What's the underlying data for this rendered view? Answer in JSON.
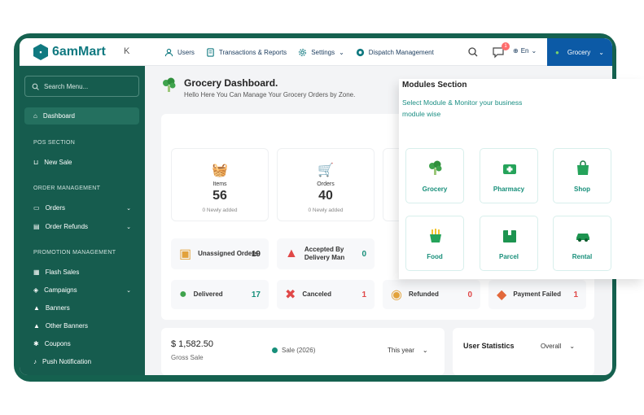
{
  "app": {
    "logo_text": "6amMart",
    "collapse_glyph": "K"
  },
  "topbar": {
    "nav": [
      {
        "label": "Users",
        "icon": "user-icon"
      },
      {
        "label": "Transactions & Reports",
        "icon": "report-icon"
      },
      {
        "label": "Settings",
        "icon": "gear-icon"
      },
      {
        "label": "Dispatch Management",
        "icon": "dispatch-icon"
      }
    ],
    "message_badge": "1",
    "language": "En",
    "module_select": "Grocery"
  },
  "sidebar": {
    "search_placeholder": "Search Menu...",
    "dashboard": "Dashboard",
    "pos_section": "POS SECTION",
    "new_sale": "New Sale",
    "order_section": "ORDER MANAGEMENT",
    "orders": "Orders",
    "order_refunds": "Order Refunds",
    "promo_section": "PROMOTION MANAGEMENT",
    "flash_sales": "Flash Sales",
    "campaigns": "Campaigns",
    "banners": "Banners",
    "other_banners": "Other Banners",
    "coupons": "Coupons",
    "push_notification": "Push Notification"
  },
  "main": {
    "title": "Grocery Dashboard.",
    "subtitle": "Hello Here You Can Manage Your Grocery Orders by Zone.",
    "stats": [
      {
        "label": "Items",
        "value": "56",
        "sub": "0 Newly added"
      },
      {
        "label": "Orders",
        "value": "40",
        "sub": "0 Newly added"
      }
    ],
    "status": {
      "unassigned_label": "Unassigned Orders",
      "unassigned_value": "19",
      "accepted_label": "Accepted By Delivery Man",
      "accepted_value": "0",
      "delivered_label": "Delivered",
      "delivered_value": "17",
      "canceled_label": "Canceled",
      "canceled_value": "1",
      "refunded_label": "Refunded",
      "refunded_value": "0",
      "failed_label": "Payment Failed",
      "failed_value": "1"
    },
    "gross": {
      "amount": "$ 1,582.50",
      "label": "Gross Sale",
      "legend": "Sale (2026)",
      "period": "This year"
    },
    "user_stats": {
      "title": "User Statistics",
      "filter": "Overall"
    }
  },
  "modules": {
    "title": "Modules Section",
    "desc": "Select Module & Monitor your business module wise",
    "items": [
      {
        "label": "Grocery",
        "icon": "broccoli-icon"
      },
      {
        "label": "Pharmacy",
        "icon": "first-aid-icon"
      },
      {
        "label": "Shop",
        "icon": "shopping-bag-icon"
      },
      {
        "label": "Food",
        "icon": "fries-icon"
      },
      {
        "label": "Parcel",
        "icon": "parcel-icon"
      },
      {
        "label": "Rental",
        "icon": "car-icon"
      }
    ]
  },
  "colors": {
    "brand": "#107980",
    "sidebar": "#165c4e",
    "accent_green": "#178f7a",
    "module_blue": "#0c5aa6",
    "red": "#e04848"
  }
}
